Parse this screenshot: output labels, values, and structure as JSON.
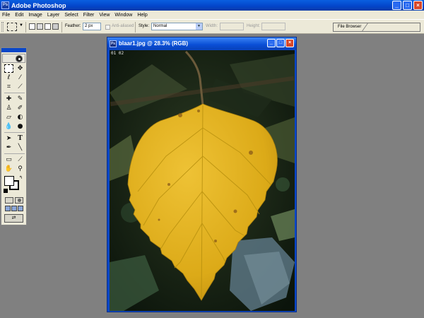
{
  "app": {
    "title": "Adobe Photoshop",
    "icon": "photoshop-app-icon",
    "window_buttons": [
      "_",
      "□",
      "×"
    ]
  },
  "menu": [
    "File",
    "Edit",
    "Image",
    "Layer",
    "Select",
    "Filter",
    "View",
    "Window",
    "Help"
  ],
  "options": {
    "feather_label": "Feather:",
    "feather_value": "2 px",
    "antialiased_label": "Anti-aliased",
    "style_label": "Style:",
    "style_value": "Normal",
    "width_label": "Width:",
    "height_label": "Height:",
    "file_browser_tab": "File Browser"
  },
  "toolbox": {
    "foreground_color": "#ffffff",
    "background_color": "#000000",
    "tools": [
      "marquee-icon",
      "move-icon",
      "lasso-icon",
      "magic-wand-icon",
      "crop-icon",
      "slice-icon",
      "healing-brush-icon",
      "brush-icon",
      "clone-stamp-icon",
      "history-brush-icon",
      "eraser-icon",
      "gradient-icon",
      "blur-icon",
      "dodge-icon",
      "path-selection-icon",
      "type-icon",
      "pen-icon",
      "line-shape-icon",
      "notes-icon",
      "eyedropper-icon",
      "hand-icon",
      "zoom-icon"
    ]
  },
  "document": {
    "title": "blaar1.jpg @ 28.3% (RGB)",
    "date_stamp": "01 02",
    "leaf_color": "#e0b31c"
  }
}
